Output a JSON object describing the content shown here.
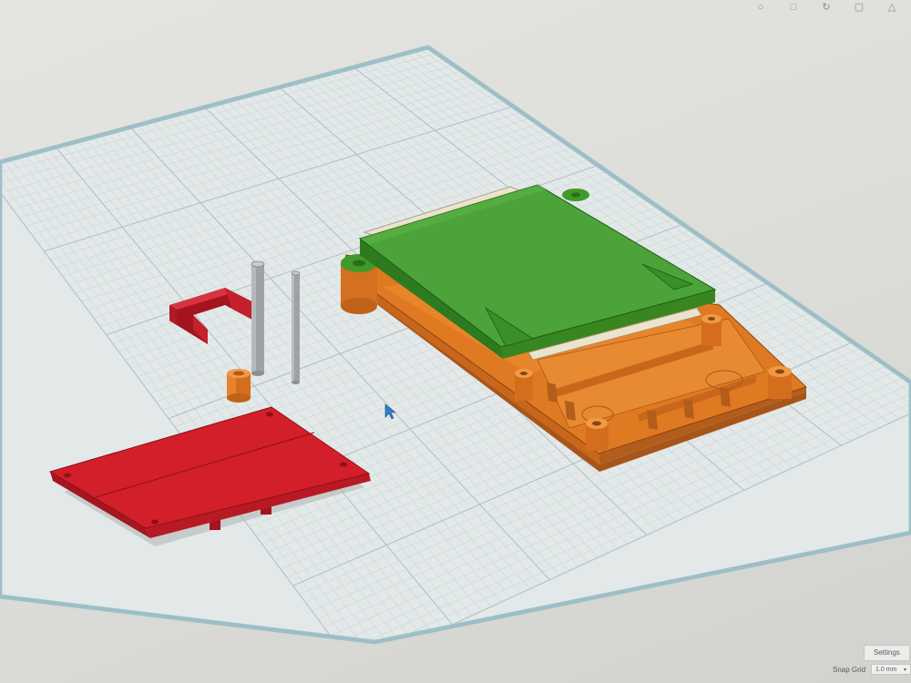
{
  "toolbar": {
    "icons": [
      "bulb-icon",
      "shape-icon",
      "rotate-icon",
      "hole-icon",
      "mirror-icon"
    ]
  },
  "settings": {
    "label": "Settings"
  },
  "snap_grid": {
    "label": "Snap Grid",
    "value": "1.0 mm"
  },
  "colors": {
    "workplane": "#e3e8e8",
    "grid_line": "#c4cfd0",
    "workplane_edge": "#8fb3be",
    "orange_case": "#e07a22",
    "green_lid": "#3f9a2a",
    "red_board": "#d21f2a",
    "red_bracket": "#c4202d",
    "cursor": "#2f7ec7"
  }
}
